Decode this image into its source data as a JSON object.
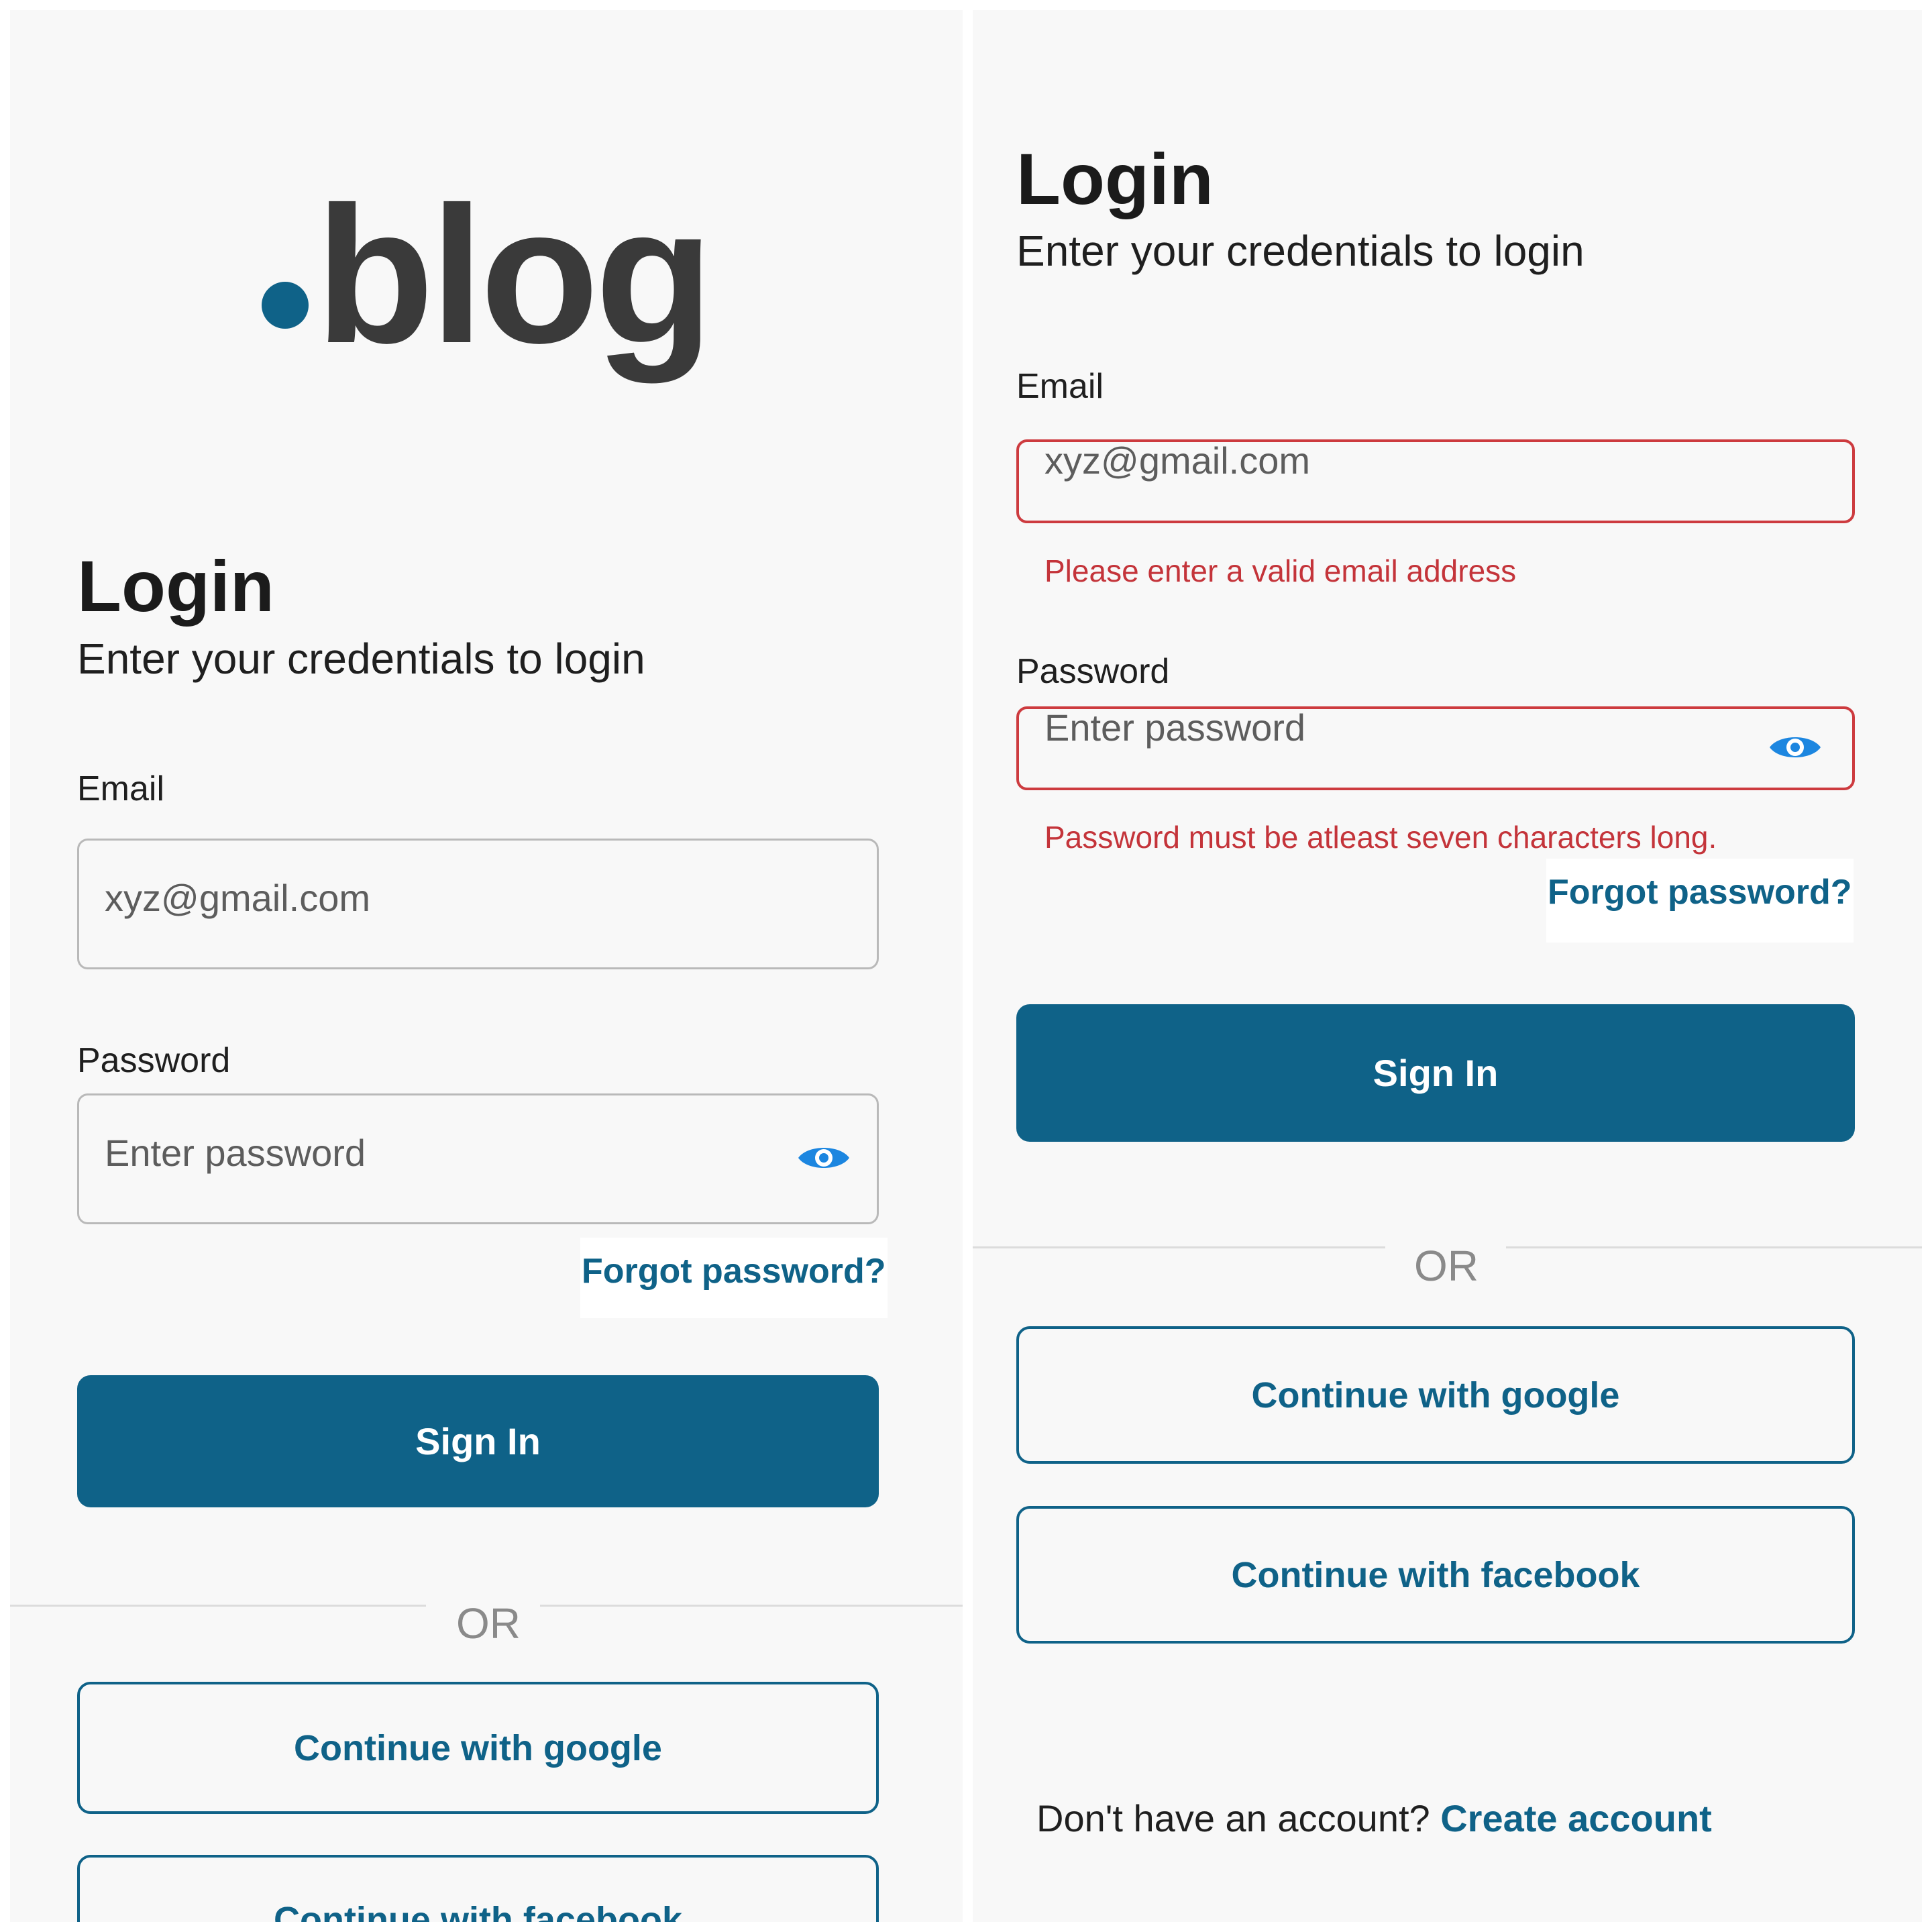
{
  "brand": {
    "logo_text": "blog",
    "accent_color": "#0f6288",
    "error_color": "#c4343a"
  },
  "left": {
    "title": "Login",
    "subtitle": "Enter your credentials to login",
    "email_label": "Email",
    "email_placeholder": "xyz@gmail.com",
    "password_label": "Password",
    "password_placeholder": "Enter password",
    "password_toggle_icon": "eye-icon",
    "forgot_label": "Forgot password?",
    "sign_in_label": "Sign In",
    "or_label": "OR",
    "google_label": "Continue with google",
    "facebook_label": "Continue with facebook"
  },
  "right": {
    "title": "Login",
    "subtitle": "Enter your credentials to login",
    "email_label": "Email",
    "email_placeholder": "xyz@gmail.com",
    "email_error": "Please enter a valid email address",
    "password_label": "Password",
    "password_placeholder": "Enter password",
    "password_error": "Password must be atleast seven characters long.",
    "password_toggle_icon": "eye-icon",
    "forgot_label": "Forgot password?",
    "sign_in_label": "Sign In",
    "or_label": "OR",
    "google_label": "Continue with google",
    "facebook_label": "Continue with facebook",
    "signup_prompt": "Don't have an account?",
    "signup_link": "Create account"
  }
}
